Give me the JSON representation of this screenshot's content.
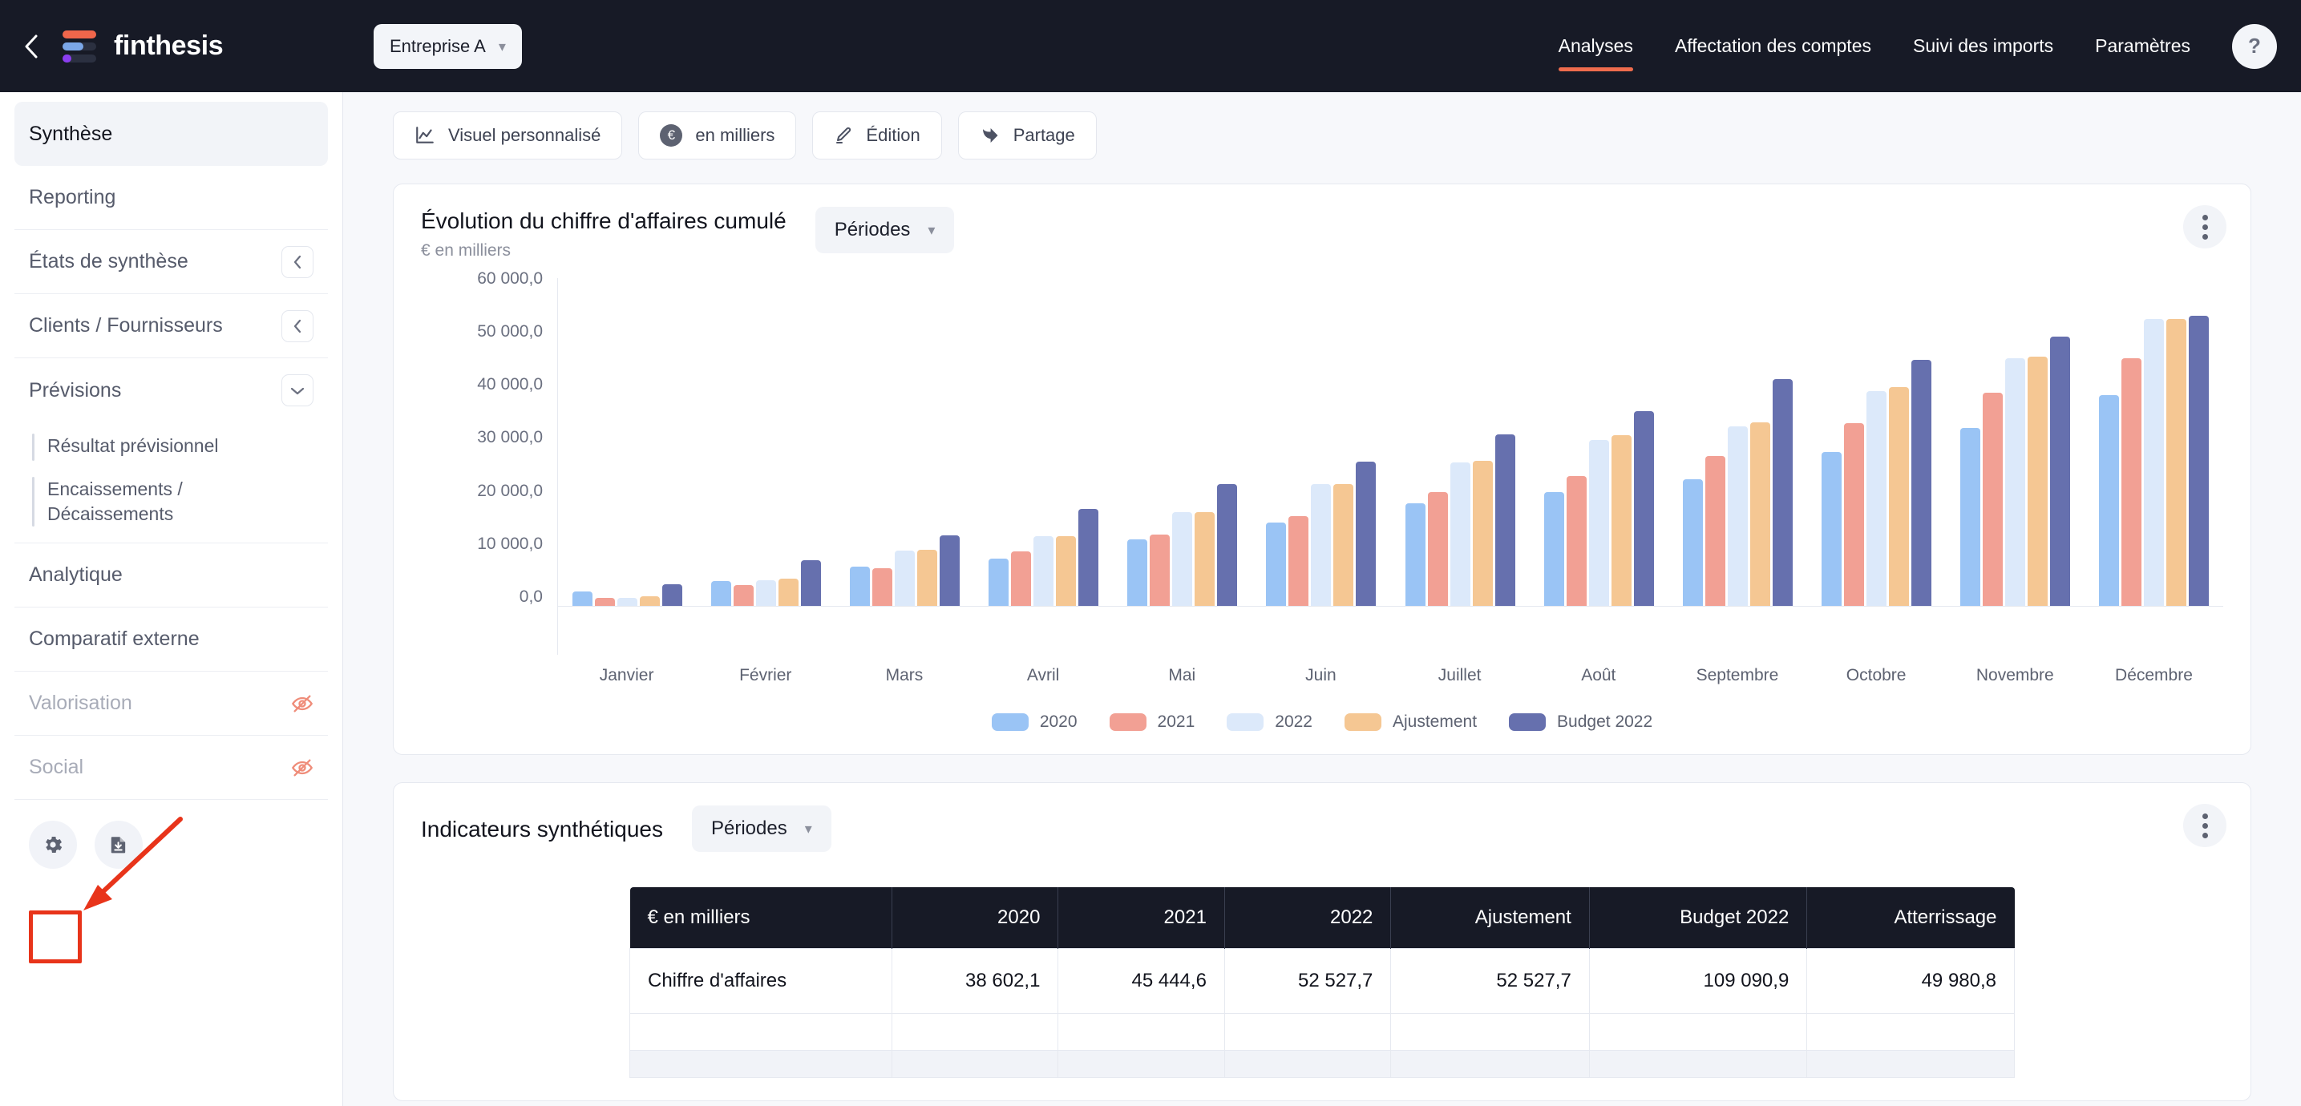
{
  "brand": {
    "name": "finthesis",
    "back_icon": "chevron-left-icon",
    "logo_icon": "finthesis-logo-icon"
  },
  "header": {
    "company_selector": {
      "label": "Entreprise A",
      "chevron": "chevron-down-icon"
    },
    "nav": [
      {
        "label": "Analyses",
        "active": true
      },
      {
        "label": "Affectation des comptes",
        "active": false
      },
      {
        "label": "Suivi des imports",
        "active": false
      },
      {
        "label": "Paramètres",
        "active": false
      }
    ],
    "help_label": "?",
    "accent_color": "#ef6c4d"
  },
  "sidebar": {
    "items": [
      {
        "label": "Synthèse",
        "state": "active",
        "affix": "none"
      },
      {
        "label": "Reporting",
        "state": "normal",
        "affix": "none"
      },
      {
        "label": "États de synthèse",
        "state": "normal",
        "affix": "chevron-left-icon"
      },
      {
        "label": "Clients / Fournisseurs",
        "state": "normal",
        "affix": "chevron-left-icon"
      },
      {
        "label": "Prévisions",
        "state": "normal",
        "affix": "chevron-down-icon"
      }
    ],
    "sub_items": [
      {
        "label": "Résultat prévisionnel"
      },
      {
        "label": "Encaissements / Décaissements"
      }
    ],
    "items_after": [
      {
        "label": "Analytique",
        "state": "normal",
        "affix": "none"
      },
      {
        "label": "Comparatif externe",
        "state": "normal",
        "affix": "none"
      },
      {
        "label": "Valorisation",
        "state": "muted",
        "affix": "eye-off-icon"
      },
      {
        "label": "Social",
        "state": "muted",
        "affix": "eye-off-icon"
      }
    ],
    "actions": [
      {
        "name": "settings-icon",
        "title": "Paramètres"
      },
      {
        "name": "document-download-icon",
        "title": "Export"
      }
    ],
    "annotation_color": "#e8341a"
  },
  "toolbar": [
    {
      "label": "Visuel personnalisé",
      "icon": "line-chart-icon"
    },
    {
      "label": "en milliers",
      "icon": "euro-circle-icon"
    },
    {
      "label": "Édition",
      "icon": "pencil-icon"
    },
    {
      "label": "Partage",
      "icon": "share-icon"
    }
  ],
  "chart_card": {
    "title": "Évolution du chiffre d'affaires cumulé",
    "subtitle": "€ en milliers",
    "period_selector": "Périodes",
    "menu_icon": "kebab-menu-icon"
  },
  "indicators_card": {
    "title": "Indicateurs synthétiques",
    "period_selector": "Périodes",
    "menu_icon": "kebab-menu-icon",
    "table": {
      "columns": [
        "€ en milliers",
        "2020",
        "2021",
        "2022",
        "Ajustement",
        "Budget 2022",
        "Atterrissage"
      ],
      "rows": [
        {
          "label": "Chiffre d'affaires",
          "values": [
            "38 602,1",
            "45 444,6",
            "52 527,7",
            "52 527,7",
            "109 090,9",
            "49 980,8"
          ]
        }
      ]
    }
  },
  "chart_data": {
    "type": "bar",
    "title": "Évolution du chiffre d'affaires cumulé",
    "subtitle": "€ en milliers",
    "xlabel": "",
    "ylabel": "€ en milliers",
    "ylim": [
      0,
      60000
    ],
    "yticks": [
      "0,0",
      "10 000,0",
      "20 000,0",
      "30 000,0",
      "40 000,0",
      "50 000,0",
      "60 000,0"
    ],
    "grid": false,
    "legend_position": "bottom",
    "categories": [
      "Janvier",
      "Février",
      "Mars",
      "Avril",
      "Mai",
      "Juin",
      "Juillet",
      "Août",
      "Septembre",
      "Octobre",
      "Novembre",
      "Décembre"
    ],
    "series": [
      {
        "name": "2020",
        "color": "#9AC4F5",
        "values": [
          2700,
          4500,
          7200,
          8700,
          12200,
          15200,
          18800,
          20900,
          23200,
          28200,
          32500,
          38600
        ]
      },
      {
        "name": "2021",
        "color": "#F2A094",
        "values": [
          1400,
          3800,
          6900,
          10000,
          13000,
          16500,
          20800,
          23800,
          27400,
          33400,
          39000,
          45400
        ]
      },
      {
        "name": "2022",
        "color": "#DCE9FA",
        "values": [
          1500,
          4700,
          10100,
          12700,
          17200,
          22300,
          26200,
          30400,
          32800,
          39300,
          45300,
          52500
        ]
      },
      {
        "name": "Ajustement",
        "color": "#F5C793",
        "values": [
          1800,
          5000,
          10200,
          12700,
          17200,
          22300,
          26500,
          31200,
          33600,
          40000,
          45600,
          52500
        ]
      },
      {
        "name": "Budget 2022",
        "color": "#6670AE",
        "values": [
          4000,
          8400,
          12900,
          17700,
          22300,
          26400,
          31400,
          35600,
          41500,
          45100,
          49300,
          53100
        ]
      }
    ]
  }
}
